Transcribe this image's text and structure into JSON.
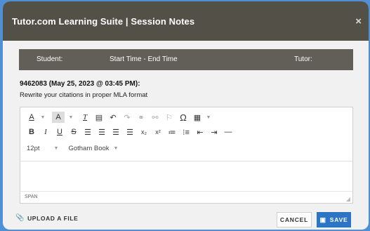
{
  "modal": {
    "title": "Tutor.com Learning Suite | Session Notes",
    "close_glyph": "×"
  },
  "info_bar": {
    "student": "Student:",
    "times": "Start Time - End Time",
    "tutor": "Tutor:"
  },
  "note": {
    "header": "9462083 (May 25, 2023 @ 03:45 PM):",
    "body": "Rewrite your citations in proper MLA format"
  },
  "editor": {
    "font_size": "12pt",
    "font_family": "Gotham Book",
    "status_path": "SPAN",
    "row1_icons": [
      "text-color-icon",
      "background-color-icon",
      "clear-formatting-icon",
      "paste-icon",
      "undo-icon",
      "redo-icon",
      "link-icon",
      "unlink-icon",
      "anchor-icon",
      "special-character-icon",
      "table-icon"
    ],
    "row2_icons": [
      "bold-icon",
      "italic-icon",
      "underline-icon",
      "strikethrough-icon",
      "align-left-icon",
      "align-center-icon",
      "align-right-icon",
      "align-justify-icon",
      "subscript-icon",
      "superscript-icon",
      "numbered-list-icon",
      "bulleted-list-icon",
      "outdent-icon",
      "indent-icon",
      "horizontal-rule-icon"
    ]
  },
  "footer": {
    "upload_label": "UPLOAD A FILE",
    "cancel_label": "CANCEL",
    "save_label": "SAVE"
  },
  "colors": {
    "titlebar": "#535048",
    "info_bar": "#625e58",
    "save_button": "#2c74c4",
    "background": "#4f8fd6"
  }
}
